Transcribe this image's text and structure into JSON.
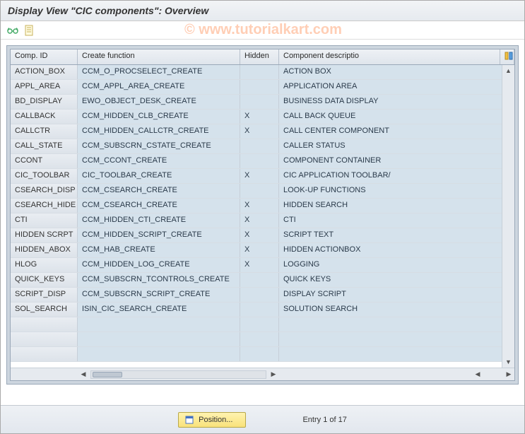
{
  "title": "Display View \"CIC components\": Overview",
  "watermark": "© www.tutorialkart.com",
  "toolbar": {
    "glasses_tip": "Display/Change",
    "sheet_tip": "Table Contents"
  },
  "columns": {
    "id": "Comp. ID",
    "fn": "Create function",
    "hidden": "Hidden",
    "desc": "Component descriptio"
  },
  "rows": [
    {
      "id": "ACTION_BOX",
      "fn": "CCM_O_PROCSELECT_CREATE",
      "hidden": "",
      "desc": "ACTION BOX"
    },
    {
      "id": "APPL_AREA",
      "fn": "CCM_APPL_AREA_CREATE",
      "hidden": "",
      "desc": "APPLICATION AREA"
    },
    {
      "id": "BD_DISPLAY",
      "fn": "EWO_OBJECT_DESK_CREATE",
      "hidden": "",
      "desc": "BUSINESS DATA DISPLAY"
    },
    {
      "id": "CALLBACK",
      "fn": "CCM_HIDDEN_CLB_CREATE",
      "hidden": "X",
      "desc": "CALL BACK QUEUE"
    },
    {
      "id": "CALLCTR",
      "fn": "CCM_HIDDEN_CALLCTR_CREATE",
      "hidden": "X",
      "desc": "CALL CENTER COMPONENT"
    },
    {
      "id": "CALL_STATE",
      "fn": "CCM_SUBSCRN_CSTATE_CREATE",
      "hidden": "",
      "desc": "CALLER STATUS"
    },
    {
      "id": "CCONT",
      "fn": "CCM_CCONT_CREATE",
      "hidden": "",
      "desc": "COMPONENT CONTAINER"
    },
    {
      "id": "CIC_TOOLBAR",
      "fn": "CIC_TOOLBAR_CREATE",
      "hidden": "X",
      "desc": "CIC APPLICATION TOOLBAR/"
    },
    {
      "id": "CSEARCH_DISP",
      "fn": "CCM_CSEARCH_CREATE",
      "hidden": "",
      "desc": "LOOK-UP FUNCTIONS"
    },
    {
      "id": "CSEARCH_HIDE",
      "fn": "CCM_CSEARCH_CREATE",
      "hidden": "X",
      "desc": "HIDDEN SEARCH"
    },
    {
      "id": "CTI",
      "fn": "CCM_HIDDEN_CTI_CREATE",
      "hidden": "X",
      "desc": "CTI"
    },
    {
      "id": "HIDDEN SCRPT",
      "fn": "CCM_HIDDEN_SCRIPT_CREATE",
      "hidden": "X",
      "desc": "SCRIPT TEXT"
    },
    {
      "id": "HIDDEN_ABOX",
      "fn": "CCM_HAB_CREATE",
      "hidden": "X",
      "desc": "HIDDEN ACTIONBOX"
    },
    {
      "id": "HLOG",
      "fn": "CCM_HIDDEN_LOG_CREATE",
      "hidden": "X",
      "desc": "LOGGING"
    },
    {
      "id": "QUICK_KEYS",
      "fn": "CCM_SUBSCRN_TCONTROLS_CREATE",
      "hidden": "",
      "desc": "QUICK KEYS"
    },
    {
      "id": "SCRIPT_DISP",
      "fn": "CCM_SUBSCRN_SCRIPT_CREATE",
      "hidden": "",
      "desc": "DISPLAY SCRIPT"
    },
    {
      "id": "SOL_SEARCH",
      "fn": "ISIN_CIC_SEARCH_CREATE",
      "hidden": "",
      "desc": "SOLUTION SEARCH"
    },
    {
      "id": "",
      "fn": "",
      "hidden": "",
      "desc": ""
    },
    {
      "id": "",
      "fn": "",
      "hidden": "",
      "desc": ""
    },
    {
      "id": "",
      "fn": "",
      "hidden": "",
      "desc": ""
    }
  ],
  "footer": {
    "position_label": "Position...",
    "entry_label": "Entry 1 of 17"
  }
}
